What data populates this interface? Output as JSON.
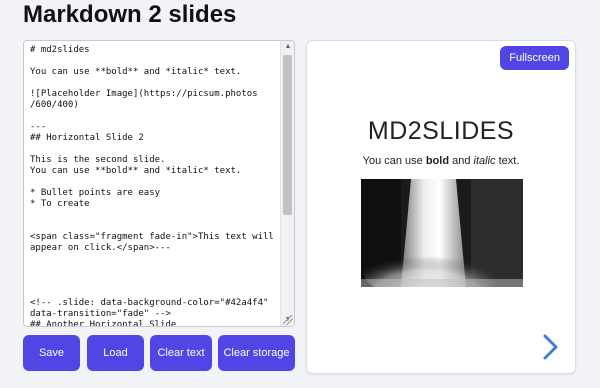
{
  "header": {
    "title": "Markdown 2 slides"
  },
  "editor": {
    "content": "# md2slides\n\nYou can use **bold** and *italic* text.\n\n![Placeholder Image](https://picsum.photos\n/600/400)\n\n---\n## Horizontal Slide 2\n\nThis is the second slide.\nYou can use **bold** and *italic* text.\n\n* Bullet points are easy\n* To create\n\n\n<span class=\"fragment fade-in\">This text will\nappear on click.</span>---\n\n\n\n\n<!-- .slide: data-background-color=\"#42a4f4\"\ndata-transition=\"fade\" -->\n## Another Horizontal Slide"
  },
  "buttons": {
    "save": "Save",
    "load": "Load",
    "clear_text": "Clear text",
    "clear_storage": "Clear storage"
  },
  "preview": {
    "fullscreen_label": "Fullscreen",
    "slide": {
      "heading": "MD2SLIDES",
      "text_prefix": "You can use ",
      "text_bold": "bold",
      "text_middle": " and ",
      "text_italic": "italic",
      "text_suffix": " text."
    },
    "image_alt": "Placeholder Image",
    "next_icon": "chevron-right-icon"
  },
  "colors": {
    "accent": "#5146e5",
    "background": "#f2f3f7",
    "arrow": "#3d7fd6"
  }
}
